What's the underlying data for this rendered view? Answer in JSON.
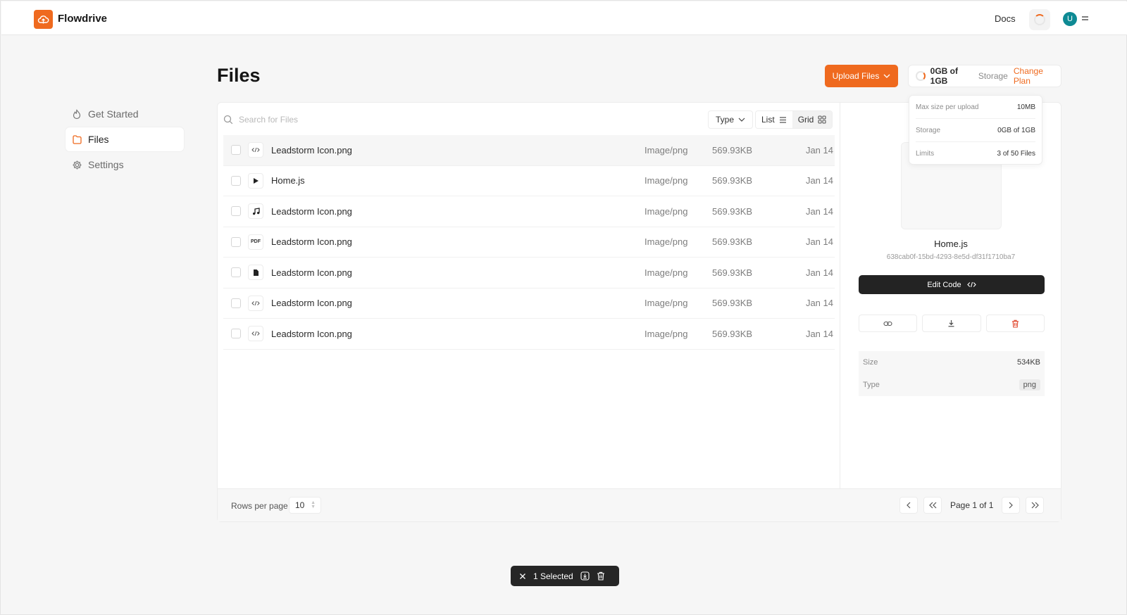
{
  "app": {
    "name": "Flowdrive"
  },
  "header": {
    "docs_label": "Docs",
    "avatar_initial": "U"
  },
  "sidebar": {
    "items": [
      {
        "label": "Get Started",
        "icon": "flame-icon"
      },
      {
        "label": "Files",
        "icon": "folder-icon"
      },
      {
        "label": "Settings",
        "icon": "gear-icon"
      }
    ]
  },
  "page": {
    "title": "Files"
  },
  "toolbar": {
    "upload_label": "Upload Files",
    "storage_used": "0GB of 1GB",
    "storage_label": "Storage",
    "change_plan_label": "Change Plan",
    "search_placeholder": "Search for Files",
    "type_filter_label": "Type",
    "view_list_label": "List",
    "view_grid_label": "Grid"
  },
  "storage_popover": {
    "rows": [
      {
        "label": "Max size per upload",
        "value": "10MB"
      },
      {
        "label": "Storage",
        "value": "0GB of 1GB"
      },
      {
        "label": "Limits",
        "value": "3 of 50 Files"
      }
    ]
  },
  "files": [
    {
      "name": "Leadstorm Icon.png",
      "mime": "Image/png",
      "size": "569.93KB",
      "date": "Jan 14",
      "icon": "code-icon",
      "selected": true
    },
    {
      "name": "Home.js",
      "mime": "Image/png",
      "size": "569.93KB",
      "date": "Jan 14",
      "icon": "play-icon",
      "selected": false
    },
    {
      "name": "Leadstorm Icon.png",
      "mime": "Image/png",
      "size": "569.93KB",
      "date": "Jan 14",
      "icon": "music-note-icon",
      "selected": false
    },
    {
      "name": "Leadstorm Icon.png",
      "mime": "Image/png",
      "size": "569.93KB",
      "date": "Jan 14",
      "icon": "pdf-icon",
      "selected": false
    },
    {
      "name": "Leadstorm Icon.png",
      "mime": "Image/png",
      "size": "569.93KB",
      "date": "Jan 14",
      "icon": "document-icon",
      "selected": false
    },
    {
      "name": "Leadstorm Icon.png",
      "mime": "Image/png",
      "size": "569.93KB",
      "date": "Jan 14",
      "icon": "code-icon",
      "selected": false
    },
    {
      "name": "Leadstorm Icon.png",
      "mime": "Image/png",
      "size": "569.93KB",
      "date": "Jan 14",
      "icon": "code-icon",
      "selected": false
    }
  ],
  "file_icon_labels": {
    "pdf": "PDF"
  },
  "pagination": {
    "rows_label": "Rows per page",
    "rows_value": "10",
    "page_label": "Page 1 of 1"
  },
  "detail": {
    "name": "Home.js",
    "id": "638cab0f-15bd-4293-8e5d-df31f1710ba7",
    "edit_label": "Edit Code",
    "meta": [
      {
        "label": "Size",
        "value": "534KB"
      },
      {
        "label": "Type",
        "value": "png"
      }
    ]
  },
  "selection": {
    "label": "1 Selected"
  },
  "colors": {
    "accent": "#ef6a1f",
    "dark": "#232323",
    "avatar": "#0e8a94"
  }
}
